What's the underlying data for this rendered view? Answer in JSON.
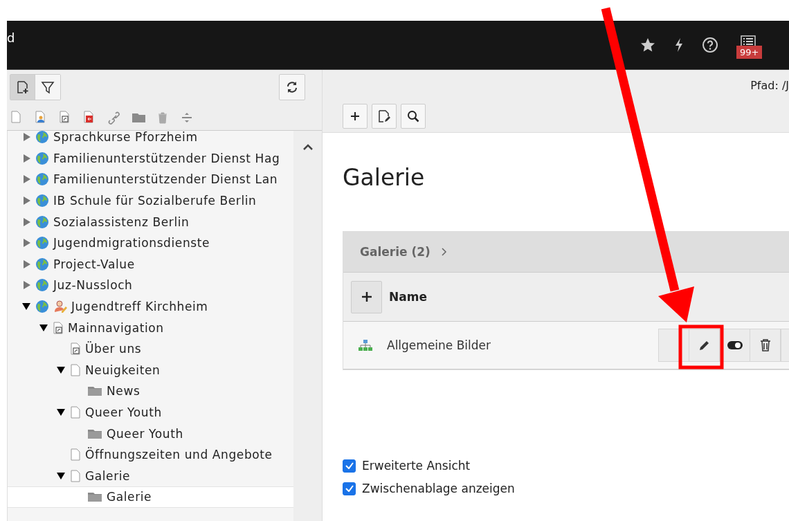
{
  "topbar": {
    "title_fragment": "d",
    "notification_badge": "99+"
  },
  "tree_toolbar": {
    "new_page_selected": true
  },
  "tree": [
    {
      "label": "Sprachkurse Pforzheim",
      "kind": "site",
      "expanded": false,
      "selected": false,
      "user_marked": false
    },
    {
      "label": "Familienunterstützender Dienst Hag",
      "kind": "site",
      "expanded": false,
      "selected": false,
      "user_marked": false
    },
    {
      "label": "Familienunterstützender Dienst Lan",
      "kind": "site",
      "expanded": false,
      "selected": false,
      "user_marked": false
    },
    {
      "label": "IB Schule für Sozialberufe Berlin",
      "kind": "site",
      "expanded": false,
      "selected": false,
      "user_marked": false
    },
    {
      "label": "Sozialassistenz Berlin",
      "kind": "site",
      "expanded": false,
      "selected": false,
      "user_marked": false
    },
    {
      "label": "Jugendmigrationsdienste",
      "kind": "site",
      "expanded": false,
      "selected": false,
      "user_marked": false
    },
    {
      "label": "Project-Value",
      "kind": "site",
      "expanded": false,
      "selected": false,
      "user_marked": false
    },
    {
      "label": "Juz-Nussloch",
      "kind": "site",
      "expanded": false,
      "selected": false,
      "user_marked": false
    },
    {
      "label": "Jugendtreff Kirchheim",
      "kind": "site",
      "expanded": true,
      "selected": false,
      "user_marked": true,
      "children": [
        {
          "label": "Mainnavigation",
          "kind": "shortcut",
          "expanded": true,
          "selected": false,
          "children": [
            {
              "label": "Über uns",
              "kind": "shortcut",
              "selected": false
            },
            {
              "label": "Neuigkeiten",
              "kind": "page",
              "expanded": true,
              "selected": false,
              "children": [
                {
                  "label": "News",
                  "kind": "folder",
                  "selected": false
                }
              ]
            },
            {
              "label": "Queer Youth",
              "kind": "page",
              "expanded": true,
              "selected": false,
              "children": [
                {
                  "label": "Queer Youth",
                  "kind": "folder",
                  "selected": false
                }
              ]
            },
            {
              "label": "Öffnungszeiten und Angebote",
              "kind": "page",
              "selected": false
            },
            {
              "label": "Galerie",
              "kind": "page",
              "expanded": true,
              "selected": false,
              "children": [
                {
                  "label": "Galerie",
                  "kind": "folder",
                  "selected": true
                }
              ]
            }
          ]
        }
      ]
    }
  ],
  "path_label": "Pfad: /J",
  "page_title": "Galerie",
  "panel": {
    "title": "Galerie (2)",
    "column": "Name",
    "rows": [
      {
        "name": "Allgemeine Bilder"
      }
    ]
  },
  "options": [
    {
      "label": "Erweiterte Ansicht",
      "checked": true
    },
    {
      "label": "Zwischenablage anzeigen",
      "checked": true
    }
  ]
}
